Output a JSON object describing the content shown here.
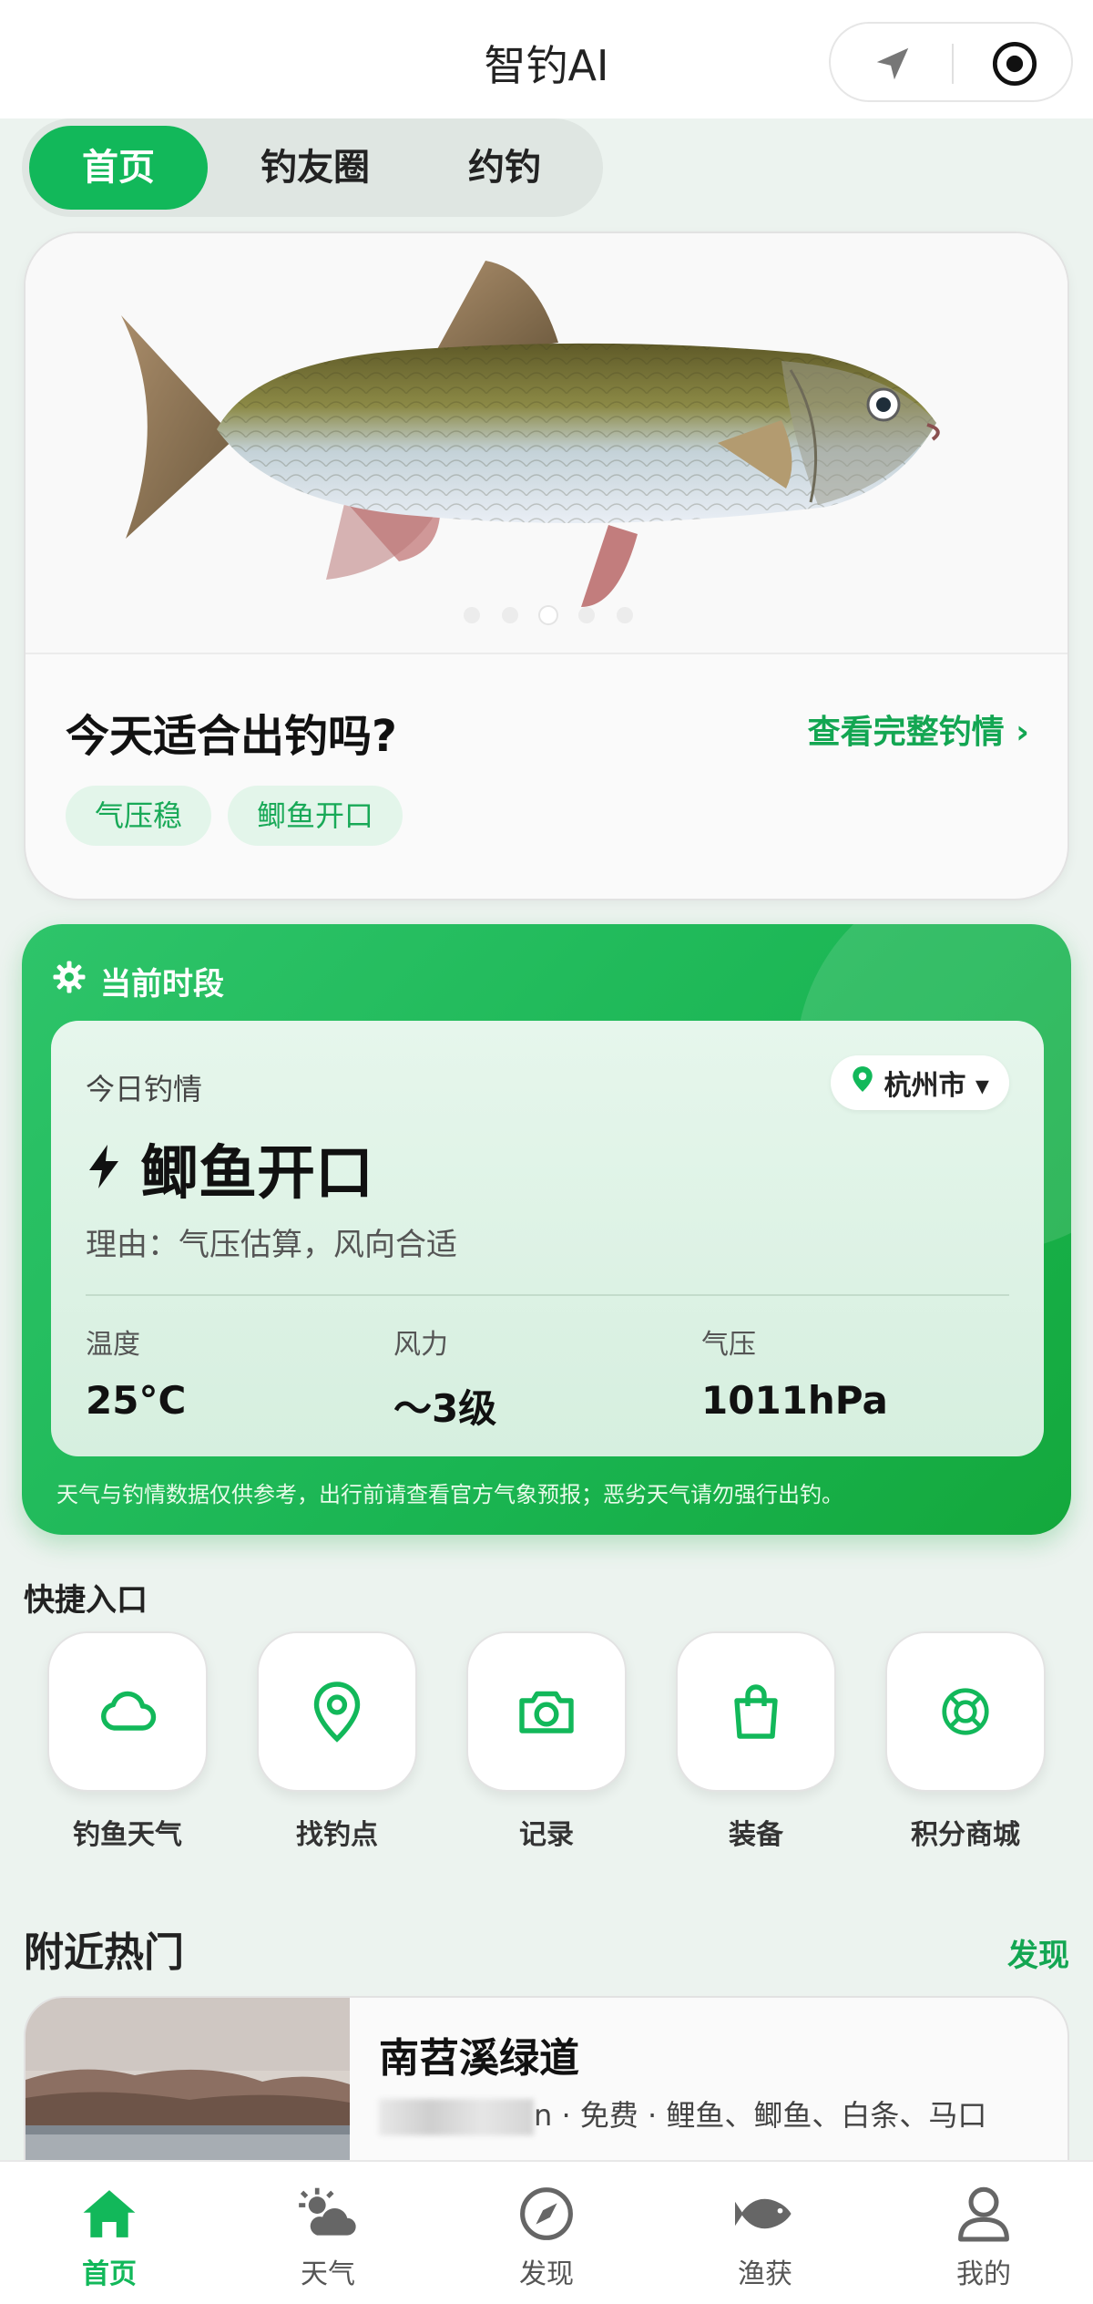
{
  "app": {
    "title": "智钓AI"
  },
  "tabs": [
    {
      "label": "首页",
      "active": true
    },
    {
      "label": "钓友圈",
      "active": false
    },
    {
      "label": "约钓",
      "active": false
    }
  ],
  "hero": {
    "question": "今天适合出钓吗?",
    "link_label": "查看完整钓情 ›",
    "chips": [
      "气压稳",
      "鲫鱼开口"
    ],
    "carousel": {
      "count": 5,
      "active_index": 2
    }
  },
  "period": {
    "header": "当前时段",
    "inner_label": "今日钓情",
    "city": "杭州市 ▾",
    "status": "鲫鱼开口",
    "reason": "理由：气压估算，风向合适",
    "metrics": [
      {
        "label": "温度",
        "value": "25°C"
      },
      {
        "label": "风力",
        "value": "～3级"
      },
      {
        "label": "气压",
        "value": "1011hPa"
      }
    ],
    "disclaimer": "天气与钓情数据仅供参考，出行前请查看官方气象预报；恶劣天气请勿强行出钓。"
  },
  "quick": {
    "title": "快捷入口",
    "items": [
      {
        "label": "钓鱼天气",
        "icon": "cloud-icon"
      },
      {
        "label": "找钓点",
        "icon": "map-pin-icon"
      },
      {
        "label": "记录",
        "icon": "camera-icon"
      },
      {
        "label": "装备",
        "icon": "shopping-bag-icon"
      },
      {
        "label": "积分商城",
        "icon": "lifebuoy-icon"
      }
    ]
  },
  "nearby": {
    "title": "附近热门",
    "more_label": "发现",
    "spot": {
      "name": "南苕溪绿道",
      "distance_suffix": "n",
      "tags": "· 免费 · 鲤鱼、鲫鱼、白条、马口"
    }
  },
  "nav": [
    {
      "label": "首页",
      "icon": "home-icon",
      "active": true
    },
    {
      "label": "天气",
      "icon": "weather-icon",
      "active": false
    },
    {
      "label": "发现",
      "icon": "compass-icon",
      "active": false
    },
    {
      "label": "渔获",
      "icon": "fish-icon",
      "active": false
    },
    {
      "label": "我的",
      "icon": "user-icon",
      "active": false
    }
  ],
  "colors": {
    "accent": "#12b85a",
    "accent_dark": "#13a652",
    "background": "#ecf3ef"
  }
}
